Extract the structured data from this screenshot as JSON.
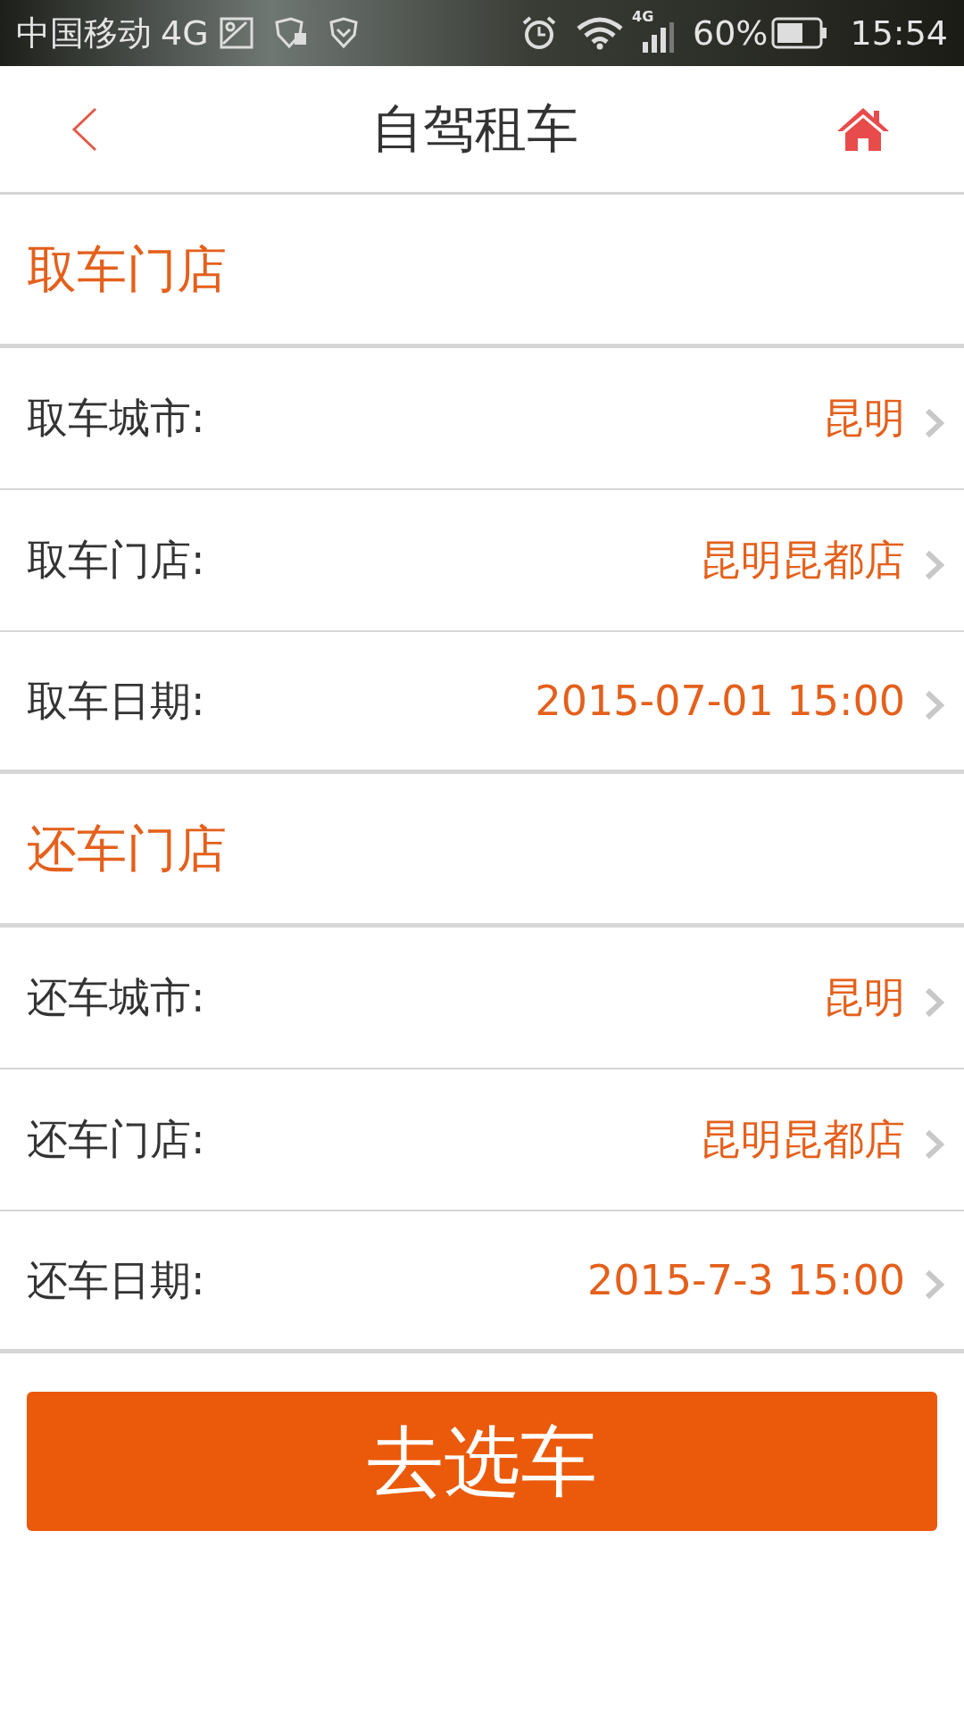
{
  "status_bar": {
    "carrier": "中国移动",
    "network": "4G",
    "signal_network": "4G",
    "battery": "60%",
    "time": "15:54"
  },
  "header": {
    "title": "自驾租车"
  },
  "sections": [
    {
      "title": "取车门店",
      "rows": [
        {
          "label": "取车城市:",
          "value": "昆明"
        },
        {
          "label": "取车门店:",
          "value": "昆明昆都店"
        },
        {
          "label": "取车日期:",
          "value": "2015-07-01 15:00"
        }
      ]
    },
    {
      "title": "还车门店",
      "rows": [
        {
          "label": "还车城市:",
          "value": "昆明"
        },
        {
          "label": "还车门店:",
          "value": "昆明昆都店"
        },
        {
          "label": "还车日期:",
          "value": "2015-7-3 15:00"
        }
      ]
    }
  ],
  "button": {
    "label": "去选车"
  }
}
